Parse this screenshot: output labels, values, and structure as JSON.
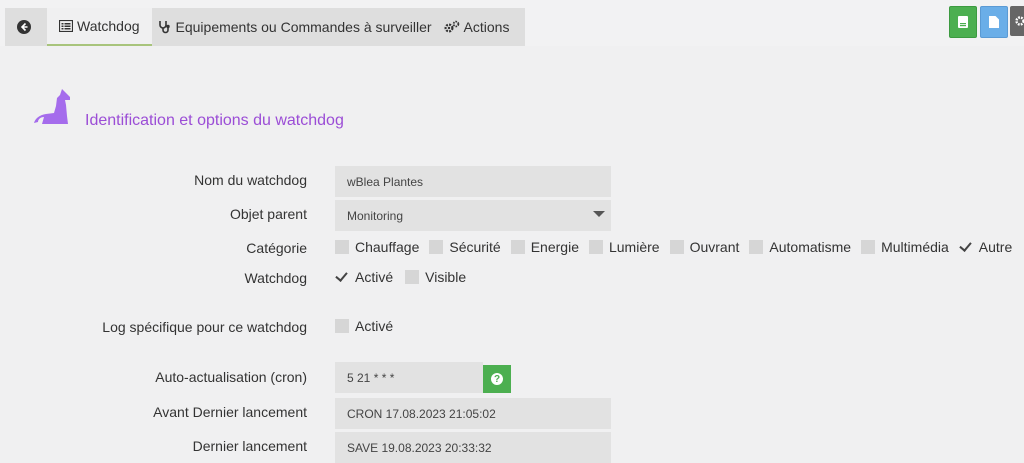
{
  "tabs": {
    "watchdog": "Watchdog",
    "equipements": "Equipements ou Commandes à surveiller",
    "actions": "Actions"
  },
  "section": {
    "title": "Identification et options du watchdog"
  },
  "form": {
    "nom_label": "Nom du watchdog",
    "nom_value": "wBlea Plantes",
    "objet_label": "Objet parent",
    "objet_value": "Monitoring",
    "categorie_label": "Catégorie",
    "categories": [
      {
        "label": "Chauffage",
        "checked": false
      },
      {
        "label": "Sécurité",
        "checked": false
      },
      {
        "label": "Energie",
        "checked": false
      },
      {
        "label": "Lumière",
        "checked": false
      },
      {
        "label": "Ouvrant",
        "checked": false
      },
      {
        "label": "Automatisme",
        "checked": false
      },
      {
        "label": "Multimédia",
        "checked": false
      },
      {
        "label": "Autre",
        "checked": true
      }
    ],
    "watchdog_label": "Watchdog",
    "watchdog_active": "Activé",
    "watchdog_visible": "Visible",
    "log_label": "Log spécifique pour ce watchdog",
    "log_active": "Activé",
    "cron_label": "Auto-actualisation (cron)",
    "cron_value": "5 21 * * *",
    "avant_label": "Avant Dernier lancement",
    "avant_value": "CRON 17.08.2023 21:05:02",
    "dernier_label": "Dernier lancement",
    "dernier_value": "SAVE 19.08.2023 20:33:32"
  },
  "colors": {
    "accent_purple": "#9b4dd6",
    "save_green": "#4caf50",
    "doc_blue": "#6aaee8"
  }
}
